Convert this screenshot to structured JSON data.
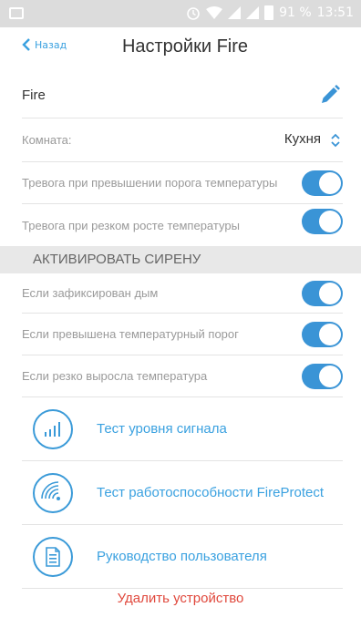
{
  "status_bar": {
    "battery": "91 %",
    "time": "13:51"
  },
  "header": {
    "back_label": "Назад",
    "title": "Настройки Fire"
  },
  "device": {
    "name": "Fire",
    "room_label": "Комната:",
    "room_value": "Кухня"
  },
  "alarms": [
    {
      "label": "Тревога при превышении порога температуры",
      "on": true
    },
    {
      "label": "Тревога при резком росте температуры",
      "on": true
    }
  ],
  "siren_section": {
    "title": "АКТИВИРОВАТЬ СИРЕНУ",
    "items": [
      {
        "label": "Если зафиксирован дым",
        "on": true
      },
      {
        "label": "Если превышена температурный порог",
        "on": true
      },
      {
        "label": "Если резко выросла температура",
        "on": true
      }
    ]
  },
  "actions": [
    {
      "label": "Тест уровня сигнала",
      "icon": "signal-bars-icon"
    },
    {
      "label": "Тест работоспособности FireProtect",
      "icon": "radio-waves-icon"
    },
    {
      "label": "Руководство пользователя",
      "icon": "document-icon"
    }
  ],
  "delete_label": "Удалить устройство",
  "colors": {
    "accent": "#3a94d6",
    "link": "#3aa1e0",
    "danger": "#e0483c",
    "status_bar": "#dcdcdc"
  }
}
